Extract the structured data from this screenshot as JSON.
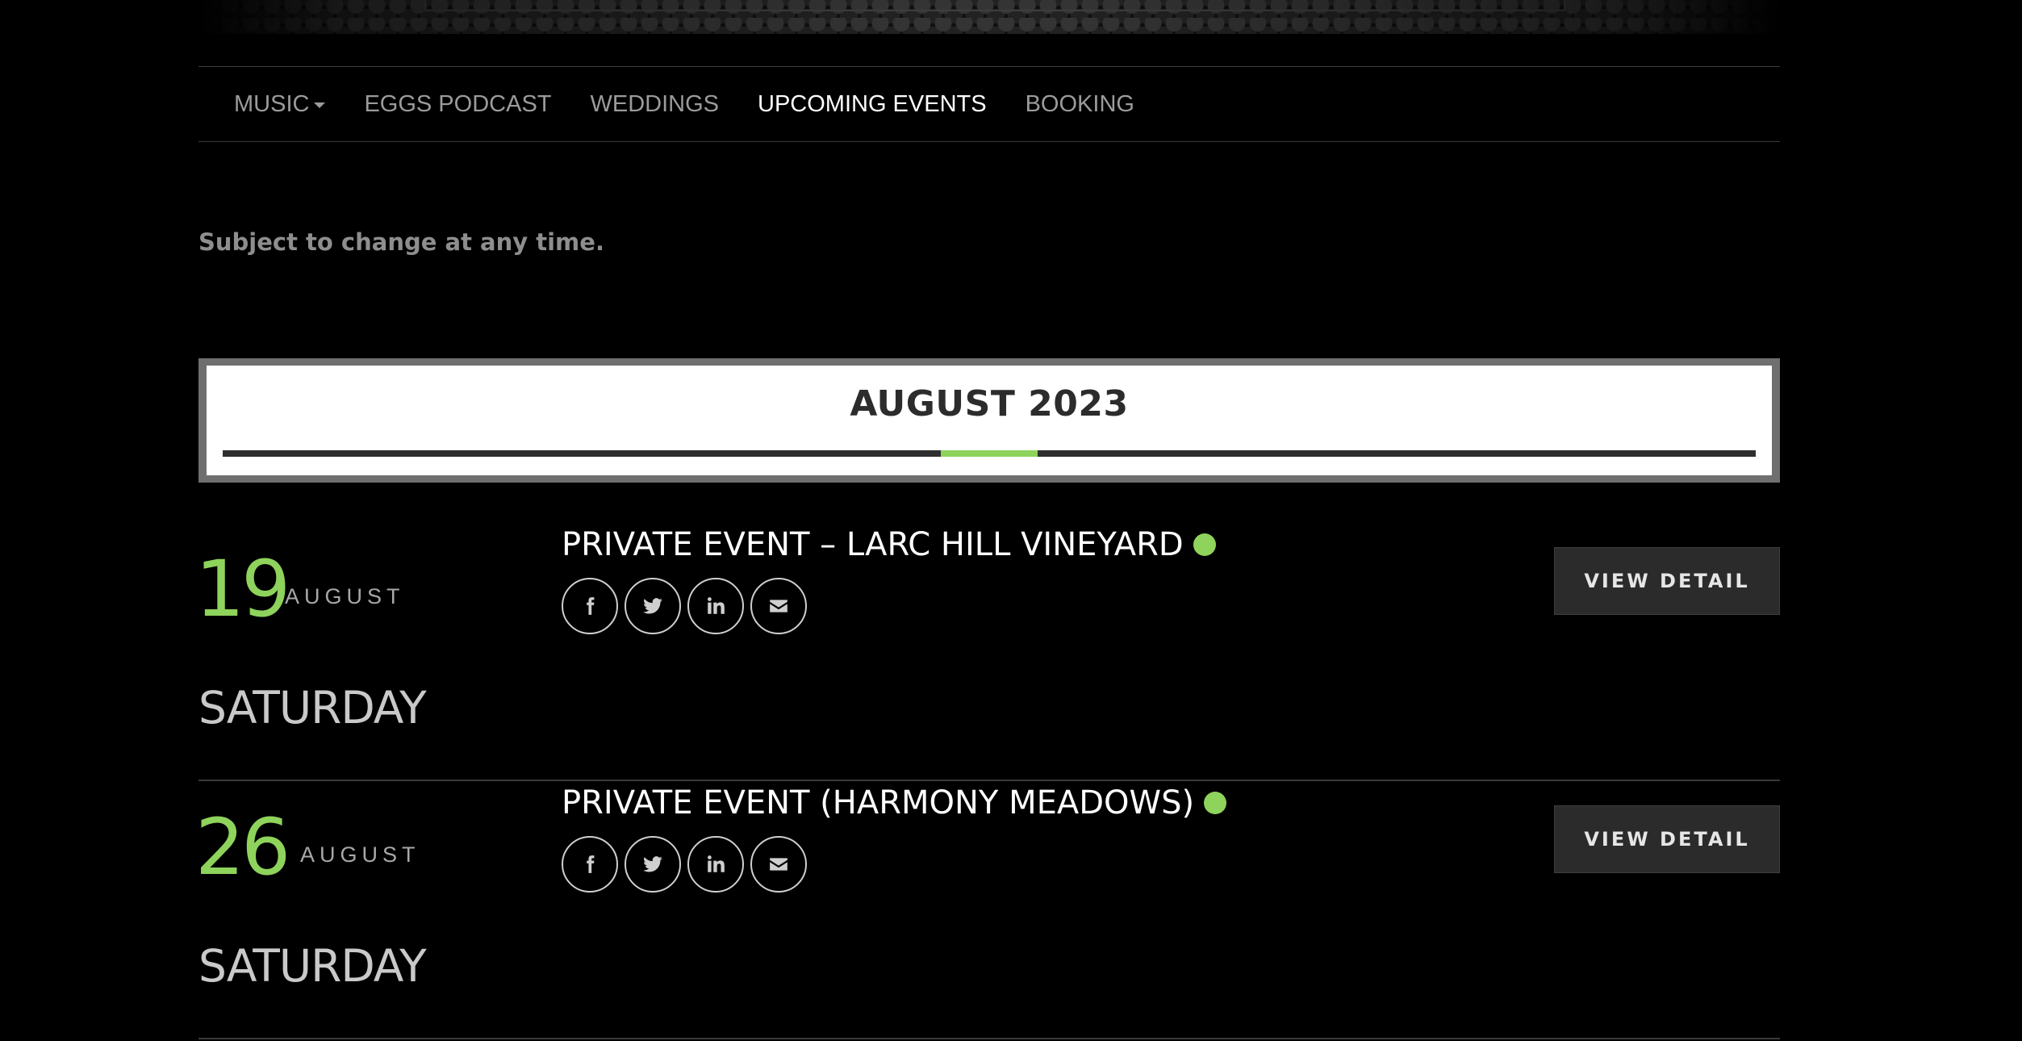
{
  "nav": {
    "items": [
      {
        "label": "MUSIC",
        "has_dropdown": true
      },
      {
        "label": "EGGS PODCAST"
      },
      {
        "label": "WEDDINGS"
      },
      {
        "label": "UPCOMING EVENTS",
        "active": true
      },
      {
        "label": "BOOKING"
      }
    ]
  },
  "notice": "Subject to change at any time.",
  "month_header": {
    "title": "AUGUST 2023",
    "accent_color": "#8ed35b"
  },
  "events": [
    {
      "day": "19",
      "month": "AUGUST",
      "weekday": "SATURDAY",
      "title": "PRIVATE EVENT – LARC HILL VINEYARD",
      "status_color": "#8ed35b",
      "share_icons": [
        "facebook-icon",
        "twitter-icon",
        "linkedin-icon",
        "email-icon"
      ],
      "button_label": "VIEW DETAIL"
    },
    {
      "day": "26",
      "month": "AUGUST",
      "weekday": "SATURDAY",
      "title": "PRIVATE EVENT (HARMONY MEADOWS)",
      "status_color": "#8ed35b",
      "share_icons": [
        "facebook-icon",
        "twitter-icon",
        "linkedin-icon",
        "email-icon"
      ],
      "button_label": "VIEW DETAIL"
    }
  ]
}
